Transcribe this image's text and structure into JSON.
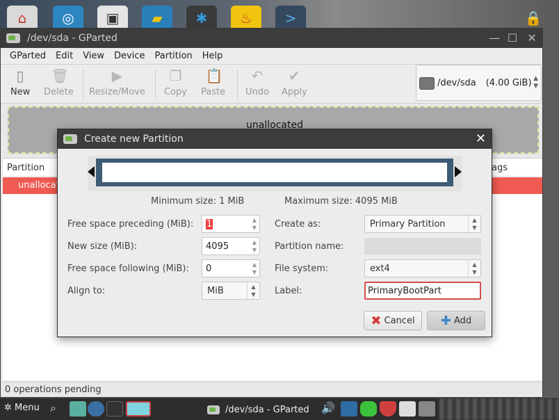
{
  "main_window": {
    "title": "/dev/sda - GParted"
  },
  "menubar": [
    "GParted",
    "Edit",
    "View",
    "Device",
    "Partition",
    "Help"
  ],
  "toolbar": {
    "new": "New",
    "delete": "Delete",
    "resize_move": "Resize/Move",
    "copy": "Copy",
    "paste": "Paste",
    "undo": "Undo",
    "apply": "Apply"
  },
  "device_selector": {
    "label": "/dev/sda",
    "size": "(4.00 GiB)"
  },
  "disk_map": {
    "label": "unallocated"
  },
  "partition_list": {
    "col_partition": "Partition",
    "col_flags": "ags",
    "rows": [
      {
        "name": "unallocated"
      }
    ]
  },
  "statusbar": {
    "text": "0 operations pending"
  },
  "dialog": {
    "title": "Create new Partition",
    "min_size": "Minimum size: 1 MiB",
    "max_size": "Maximum size: 4095 MiB",
    "free_preceding_label": "Free space preceding (MiB):",
    "free_preceding_value": "1",
    "new_size_label": "New size (MiB):",
    "new_size_value": "4095",
    "free_following_label": "Free space following (MiB):",
    "free_following_value": "0",
    "align_label": "Align to:",
    "align_value": "MiB",
    "create_as_label": "Create as:",
    "create_as_value": "Primary Partition",
    "partition_name_label": "Partition name:",
    "partition_name_value": "",
    "file_system_label": "File system:",
    "file_system_value": "ext4",
    "label_label": "Label:",
    "label_value": "PrimaryBootPart",
    "cancel": "Cancel",
    "add": "Add"
  },
  "taskbar": {
    "menu": "Menu",
    "task_title": "/dev/sda - GParted"
  },
  "colors": {
    "selected_row": "#ef5a52",
    "partition_bar": "#3e5b75",
    "disk_map_border": "#d8e8a0"
  }
}
